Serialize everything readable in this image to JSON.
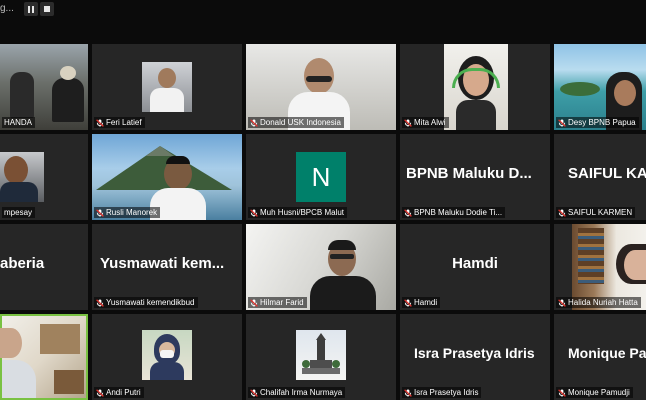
{
  "window": {
    "title": "g..."
  },
  "controls": {
    "pause": "pause-icon",
    "stop": "stop-icon"
  },
  "colors": {
    "tile_bg": "#262626",
    "active_speaker": "#79c142",
    "avatar": "#00806a",
    "muted": "#e0312c"
  },
  "participants": [
    {
      "label": "HANDA",
      "muted": false
    },
    {
      "label": "Feri Latief",
      "muted": true
    },
    {
      "label": "Donald USK Indonesia",
      "muted": true
    },
    {
      "label": "Mita Alwi",
      "muted": true
    },
    {
      "label": "Desy BPNB Papua",
      "muted": true
    },
    {
      "label": "mpesay",
      "muted": false
    },
    {
      "label": "Rusli Manorek",
      "muted": true
    },
    {
      "label": "Muh Husni/BPCB Malut",
      "muted": true,
      "avatar_letter": "N"
    },
    {
      "label": "BPNB Maluku Dodie Ti...",
      "display_name": "BPNB Maluku D...",
      "muted": true
    },
    {
      "label": "SAIFUL KARMEN",
      "display_name": "SAIFUL KA",
      "muted": true
    },
    {
      "label": "",
      "display_name": "aberia",
      "muted": false
    },
    {
      "label": "Yusmawati kemendikbud",
      "display_name": "Yusmawati kem...",
      "muted": true
    },
    {
      "label": "Hilmar Farid",
      "muted": true
    },
    {
      "label": "Hamdi",
      "display_name": "Hamdi",
      "muted": true
    },
    {
      "label": "Halida Nuriah Hatta",
      "muted": true
    },
    {
      "label": "",
      "muted": false
    },
    {
      "label": "Andi Putri",
      "muted": true
    },
    {
      "label": "Chalifah Irma Nurmaya",
      "muted": true
    },
    {
      "label": "Isra Prasetya Idris",
      "display_name": "Isra Prasetya Idris",
      "muted": true
    },
    {
      "label": "Monique Pamudji",
      "display_name": "Monique Pa",
      "muted": true
    }
  ]
}
